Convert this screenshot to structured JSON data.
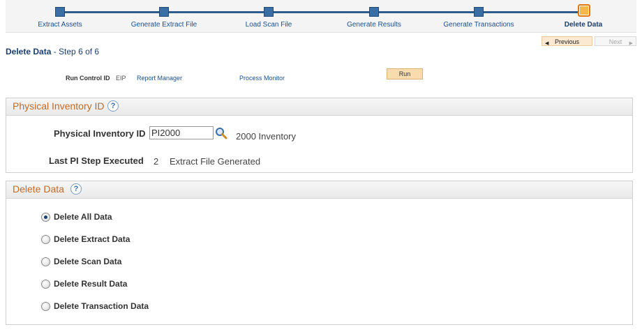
{
  "train": {
    "steps": [
      {
        "label": "Extract Assets"
      },
      {
        "label": "Generate Extract File"
      },
      {
        "label": "Load Scan File"
      },
      {
        "label": "Generate Results"
      },
      {
        "label": "Generate Transactions"
      },
      {
        "label": "Delete Data",
        "current": true
      }
    ]
  },
  "nav": {
    "previous": "Previous",
    "next": "Next"
  },
  "page": {
    "title": "Delete Data",
    "step_text": "- Step 6 of 6"
  },
  "run_control": {
    "label": "Run Control ID",
    "value": "EIP",
    "report_manager": "Report Manager",
    "process_monitor": "Process Monitor",
    "run_button": "Run"
  },
  "physical_inventory": {
    "section_title": "Physical Inventory ID",
    "help_glyph": "?",
    "id_label": "Physical Inventory ID",
    "id_value": "PI2000",
    "id_description": "2000 Inventory",
    "last_step_label": "Last PI Step Executed",
    "last_step_number": "2",
    "last_step_description": "Extract File Generated"
  },
  "delete_data": {
    "section_title": "Delete Data",
    "help_glyph": "?",
    "options": [
      {
        "label": "Delete All Data",
        "selected": true
      },
      {
        "label": "Delete Extract Data",
        "selected": false
      },
      {
        "label": "Delete Scan Data",
        "selected": false
      },
      {
        "label": "Delete Result Data",
        "selected": false
      },
      {
        "label": "Delete Transaction Data",
        "selected": false
      }
    ]
  },
  "icons": {
    "lookup": "magnifier-icon",
    "help": "help-icon"
  },
  "colors": {
    "accent": "#1a3f6e",
    "section_title": "#c06a28",
    "run_button": "#f8dcae"
  }
}
